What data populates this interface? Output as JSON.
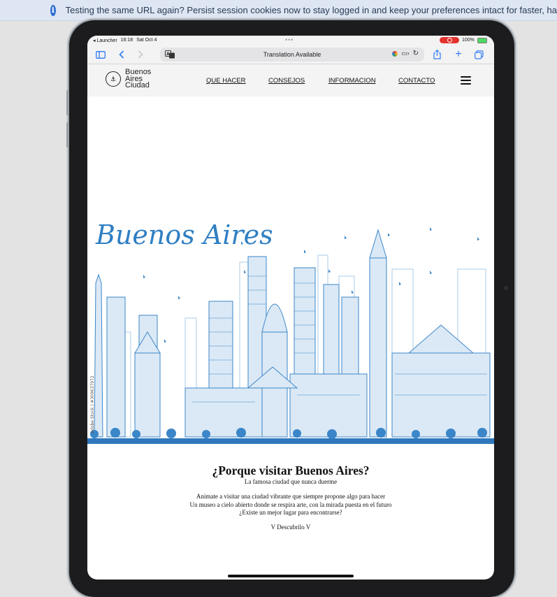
{
  "banner": {
    "info_icon": "info-icon",
    "text": "Testing the same URL again? Persist session cookies now to stay logged in and keep your preferences intact for faster, ha"
  },
  "statusbar": {
    "app": "◂ Launcher",
    "time": "16:18",
    "date": "Sat Oct 4",
    "battery": "100%",
    "recording_color": "#e5322d"
  },
  "browser": {
    "address_text": "Translation Available",
    "icons": [
      "sidebar-icon",
      "back-icon",
      "forward-icon",
      "translate-icon",
      "reload-icon",
      "share-icon",
      "new-tab-icon",
      "tabs-icon"
    ]
  },
  "site": {
    "logo": {
      "line1": "Buenos",
      "line2": "Aires",
      "line3": "Ciudad"
    },
    "nav": [
      {
        "label": "QUE HACER"
      },
      {
        "label": "CONSEJOS"
      },
      {
        "label": "INFORMACION"
      },
      {
        "label": "CONTACTO"
      }
    ],
    "hero": {
      "script_title": "Buenos Aires",
      "stock_caption": "Adobe Stock | #309637972",
      "skyline_color": "#3b86c8"
    },
    "content": {
      "title": "¿Porque visitar Buenos Aires?",
      "subtitle": "La famosa ciudad que nunca duerme",
      "paragraph": [
        "Animate a visitar una ciudad vibrante que siempre propone algo para hacer",
        "Un museo a cielo abierto donde se respira arte, con la mirada puesta en el futuro",
        "¿Existe un mejor lugar para encontrarse?"
      ],
      "cta": "V Descubrilo V"
    }
  }
}
